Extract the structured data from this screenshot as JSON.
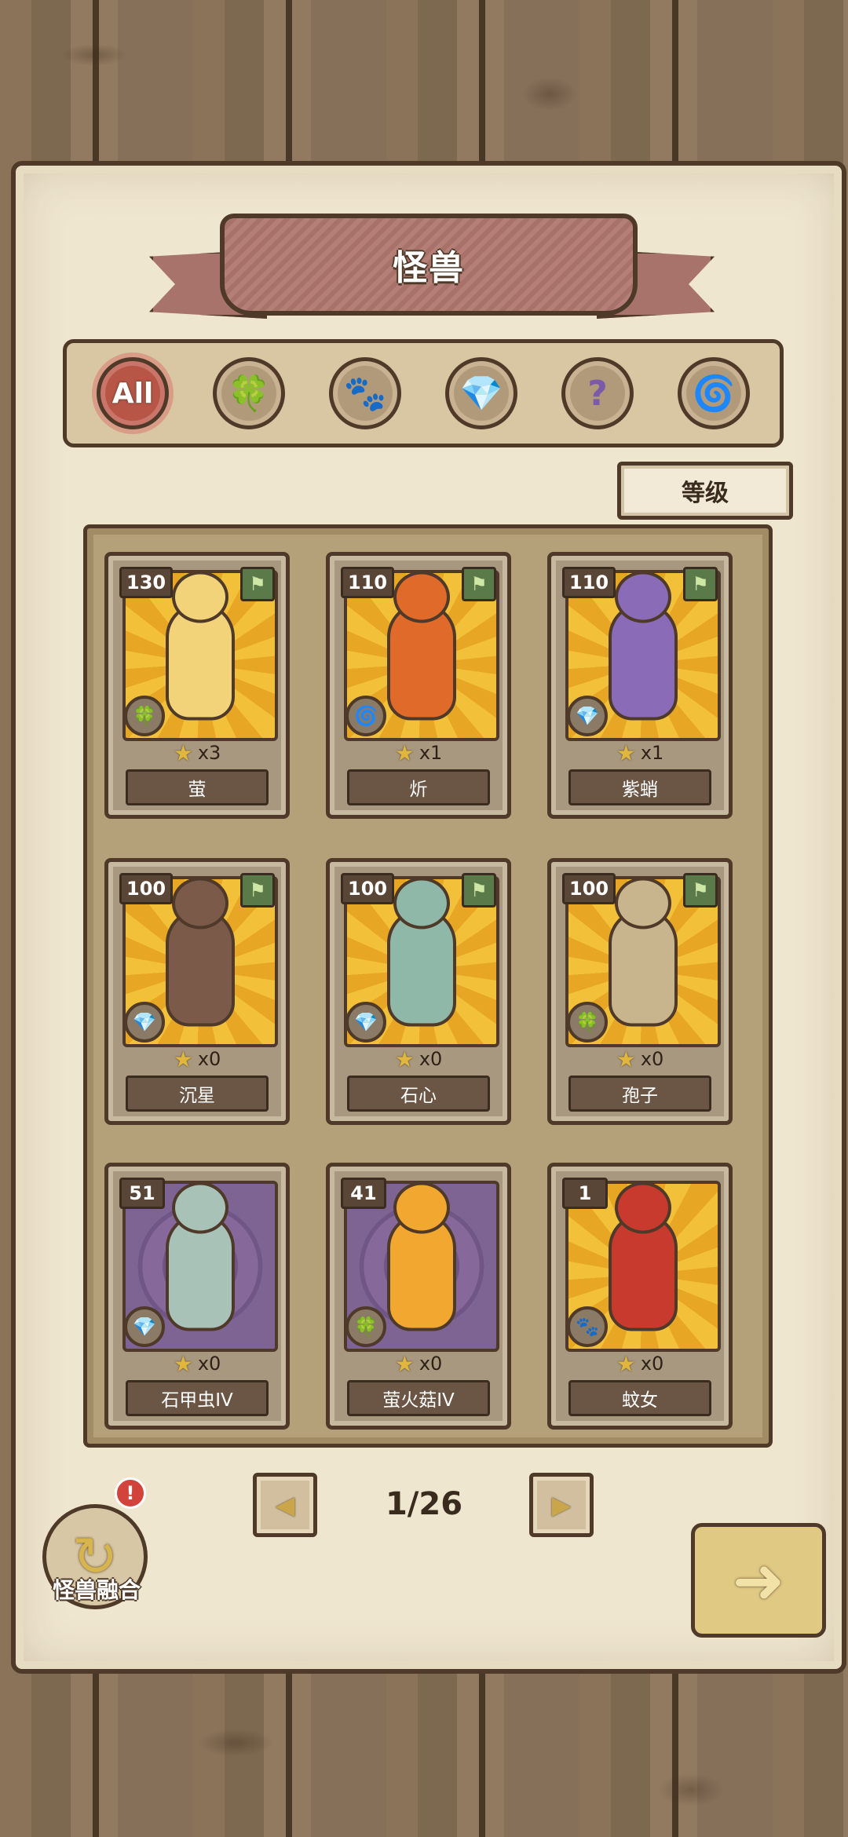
{
  "title": "怪兽",
  "filters": [
    {
      "label": "All",
      "icon": "all-icon",
      "active": true
    },
    {
      "label": "",
      "icon": "leaf-icon",
      "glyph": "🍀"
    },
    {
      "label": "",
      "icon": "paw-icon",
      "glyph": "🐾"
    },
    {
      "label": "",
      "icon": "crystal-icon",
      "glyph": "💎"
    },
    {
      "label": "",
      "icon": "question-icon",
      "glyph": "?"
    },
    {
      "label": "",
      "icon": "spiral-icon",
      "glyph": "🌀"
    }
  ],
  "sort_label": "等级",
  "cards": [
    {
      "level": "130",
      "count": "x3",
      "name": "萤",
      "bg": "gold",
      "element": "leaf-icon",
      "glyph": "🍀",
      "flag": true,
      "color": "#f3d37a"
    },
    {
      "level": "110",
      "count": "x1",
      "name": "炘",
      "bg": "gold",
      "element": "spiral-icon",
      "glyph": "🌀",
      "flag": true,
      "color": "#e06a2a"
    },
    {
      "level": "110",
      "count": "x1",
      "name": "紫蛸",
      "bg": "gold",
      "element": "crystal-icon",
      "glyph": "💎",
      "flag": true,
      "color": "#8a6bb8"
    },
    {
      "level": "100",
      "count": "x0",
      "name": "沉星",
      "bg": "gold",
      "element": "crystal-icon",
      "glyph": "💎",
      "flag": true,
      "color": "#7b5a4a"
    },
    {
      "level": "100",
      "count": "x0",
      "name": "石心",
      "bg": "gold",
      "element": "crystal-icon",
      "glyph": "💎",
      "flag": true,
      "color": "#8fb8a8"
    },
    {
      "level": "100",
      "count": "x0",
      "name": "孢子",
      "bg": "gold",
      "element": "leaf-icon",
      "glyph": "🍀",
      "flag": true,
      "color": "#c8b58e"
    },
    {
      "level": "51",
      "count": "x0",
      "name": "石甲虫IV",
      "bg": "purple",
      "element": "crystal-icon",
      "glyph": "💎",
      "flag": false,
      "color": "#a8c2b8"
    },
    {
      "level": "41",
      "count": "x0",
      "name": "萤火菇IV",
      "bg": "purple",
      "element": "leaf-icon",
      "glyph": "🍀",
      "flag": false,
      "color": "#f2a830"
    },
    {
      "level": "1",
      "count": "x0",
      "name": "蚊女",
      "bg": "gold",
      "element": "paw-icon",
      "glyph": "🐾",
      "flag": false,
      "color": "#c93a2e"
    }
  ],
  "pagination": {
    "label": "1/26"
  },
  "fusion_label": "怪兽融合",
  "alert_glyph": "!"
}
